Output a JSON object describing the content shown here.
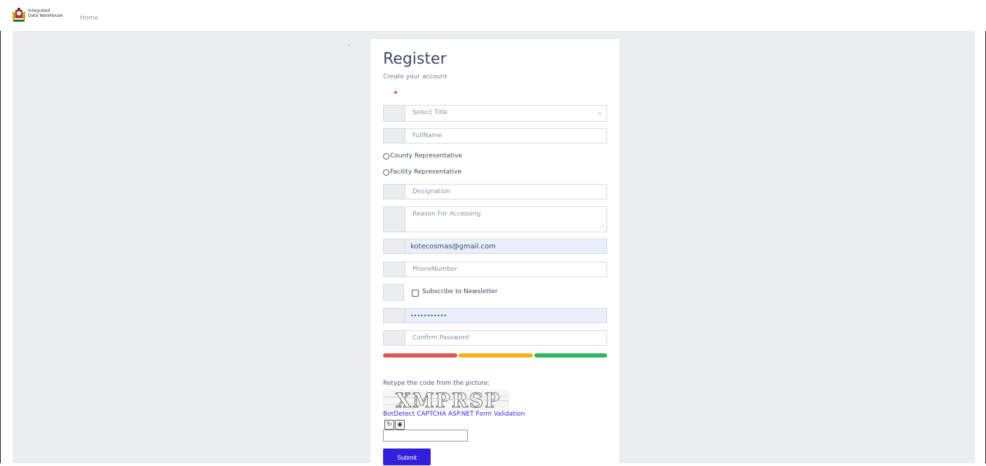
{
  "nav": {
    "logo_text_line1": "Integrated",
    "logo_text_line2": "Data Warehouse",
    "home": "Home"
  },
  "form": {
    "title": "Register",
    "subtitle": "Create your account",
    "select_title_placeholder": "Select Title",
    "fullname_placeholder": "FullName",
    "radio_county": "County Representative",
    "radio_facility": "Facility Representative",
    "designation_placeholder": "Designation",
    "reason_placeholder": "Reason For Accessing",
    "email_value": "kotecosmas@gmail.com",
    "phone_placeholder": "PhoneNumber",
    "newsletter_label": "Subscribe to Newsletter",
    "password_value": "•••••••••••",
    "confirm_password_placeholder": "Confirm Password",
    "strength_colors": [
      "#e55353",
      "#f9b115",
      "#2eb85c"
    ]
  },
  "captcha": {
    "label": "Retype the code from the picture:",
    "code_image_text": "XMPRSP",
    "link": "BotDetect CAPTCHA ASP.NET Form Validation",
    "reload_icon": "↻",
    "sound_icon": "◉"
  },
  "submit_label": "Submit",
  "colors": {
    "accent": "#321fdb",
    "title": "#3c4b64",
    "bg": "#ebedef"
  }
}
